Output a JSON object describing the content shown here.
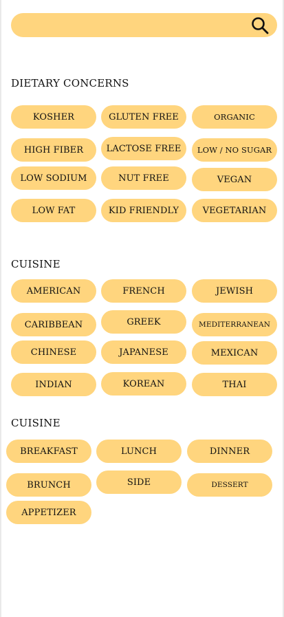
{
  "search": {
    "placeholder": "",
    "value": "",
    "icon": "search-icon"
  },
  "sections": [
    {
      "heading": "DIETARY CONCERNS",
      "chips": [
        "KOSHER",
        "GLUTEN FREE",
        "ORGANIC",
        "HIGH FIBER",
        "LACTOSE FREE",
        "LOW / NO SUGAR",
        "LOW SODIUM",
        "NUT FREE",
        "VEGAN",
        "LOW FAT",
        "KID FRIENDLY",
        "VEGETARIAN"
      ]
    },
    {
      "heading": "CUISINE",
      "chips": [
        "AMERICAN",
        "FRENCH",
        "JEWISH",
        "CARIBBEAN",
        "GREEK",
        "MEDITERRANEAN",
        "CHINESE",
        "JAPANESE",
        "MEXICAN",
        "INDIAN",
        "KOREAN",
        "THAI"
      ]
    },
    {
      "heading": "CUISINE",
      "chips": [
        "BREAKFAST",
        "LUNCH",
        "DINNER",
        "BRUNCH",
        "SIDE",
        "DESSERT",
        "APPETIZER"
      ]
    }
  ],
  "colors": {
    "chip": "#ffd57e",
    "background": "#ffffff"
  }
}
